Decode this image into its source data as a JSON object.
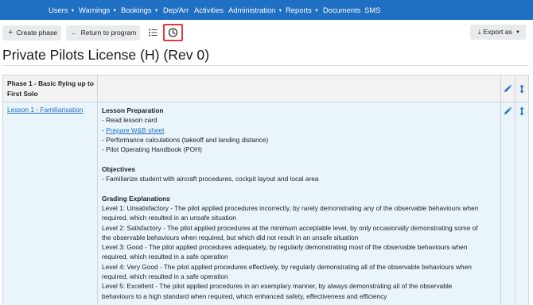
{
  "nav": {
    "items": [
      {
        "label": "Users",
        "dropdown": true
      },
      {
        "label": "Warnings",
        "dropdown": true
      },
      {
        "label": "Bookings",
        "dropdown": true
      },
      {
        "label": "Dep/Arr",
        "dropdown": false
      },
      {
        "label": "Activities",
        "dropdown": false
      },
      {
        "label": "Administration",
        "dropdown": true
      },
      {
        "label": "Reports",
        "dropdown": true
      },
      {
        "label": "Documents",
        "dropdown": false
      },
      {
        "label": "SMS",
        "dropdown": false
      }
    ]
  },
  "toolbar": {
    "create_phase_label": "Create phase",
    "create_phase_icon": "+",
    "return_label": "Return to program",
    "return_icon": "←",
    "list_icon": "list-icon",
    "history_icon": "clock-icon",
    "export_label": "Export as",
    "export_icon": "download-icon"
  },
  "page": {
    "title": "Private Pilots License (H) (Rev 0)"
  },
  "table": {
    "phase_title": "Phase 1 - Basic flying up to First Solo",
    "lesson_link": "Lesson 1 - Familiarisation",
    "lesson_prep_heading": "Lesson Preparation",
    "lesson_prep_items": [
      "- Read lesson card",
      "- ",
      "- Performance calculations (takeoff and landing distance)",
      "- Pilot Operating Handbook (POH)"
    ],
    "wb_link": "Prepare W&B sheet",
    "objectives_heading": "Objectives",
    "objectives_items": [
      "- Familiarize student with aircraft procedures, cockpit layout and local area"
    ],
    "grading_heading": "Grading Explanations",
    "grading_lines": [
      "Level 1: Unsatisfactory - The pilot applied procedures incorrectly, by rarely demonstrating any of the observable behaviours when",
      "required, which resulted in an unsafe situation",
      "Level 2: Satisfactory - The pilot applied procedures at the minimum acceptable level, by only occasionally demonstrating some of",
      "the observable behaviours when required, but which did not result in an unsafe situation",
      "Level 3: Good - The pilot applied procedures adequately, by regularly demonstrating most of the observable behaviours when",
      "required, which resulted in a safe operation",
      "Level 4: Very Good - The pilot applied procedures effectively, by regularly demonstrating all of the observable behaviours when",
      "required, which resulted in a safe operation",
      "Level 5: Excellent - The pilot applied procedures in an exemplary manner, by always demonstrating all of the observable",
      "behaviours to a high standard when required, which enhanced safety, effectiveness and efficiency"
    ],
    "row_icons": [
      "pencil-icon",
      "move-vertical-icon"
    ]
  },
  "colors": {
    "nav_bg": "#1f6fc2",
    "link": "#1f6fc2",
    "highlight": "#e03a3a",
    "row_bg": "#eaf4fb",
    "head_bg": "#f2f2f2"
  }
}
